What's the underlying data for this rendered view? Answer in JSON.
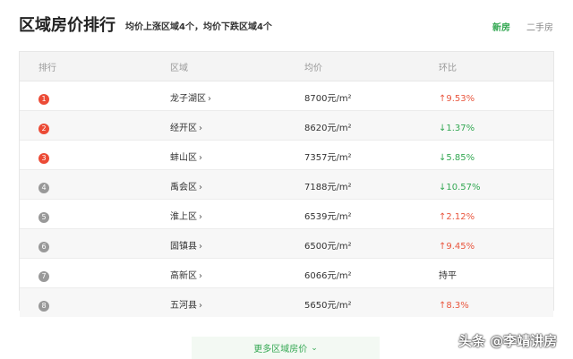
{
  "header": {
    "title": "区域房价排行",
    "summary": "均价上涨区域4个，均价下跌区域4个",
    "tabs": [
      {
        "label": "新房",
        "active": true
      },
      {
        "label": "二手房",
        "active": false
      }
    ]
  },
  "table": {
    "columns": [
      "排行",
      "区域",
      "均价",
      "环比"
    ],
    "rows": [
      {
        "rank": "1",
        "region": "龙子湖区",
        "price": "8700元/m²",
        "change": "↑9.53%",
        "trend": "up"
      },
      {
        "rank": "2",
        "region": "经开区",
        "price": "8620元/m²",
        "change": "↓1.37%",
        "trend": "down"
      },
      {
        "rank": "3",
        "region": "蚌山区",
        "price": "7357元/m²",
        "change": "↓5.85%",
        "trend": "down"
      },
      {
        "rank": "4",
        "region": "禹会区",
        "price": "7188元/m²",
        "change": "↓10.57%",
        "trend": "down"
      },
      {
        "rank": "5",
        "region": "淮上区",
        "price": "6539元/m²",
        "change": "↑2.12%",
        "trend": "up"
      },
      {
        "rank": "6",
        "region": "固镇县",
        "price": "6500元/m²",
        "change": "↑9.45%",
        "trend": "up"
      },
      {
        "rank": "7",
        "region": "高新区",
        "price": "6066元/m²",
        "change": "持平",
        "trend": "flat"
      },
      {
        "rank": "8",
        "region": "五河县",
        "price": "5650元/m²",
        "change": "↑8.3%",
        "trend": "up"
      }
    ]
  },
  "more_button": {
    "label": "更多区域房价"
  },
  "watermark": "头条 @李靖讲房",
  "colors": {
    "accent_green": "#34a853",
    "up_red": "#e9573f",
    "rank_top": "#ec4b36",
    "rank_other": "#999999"
  }
}
